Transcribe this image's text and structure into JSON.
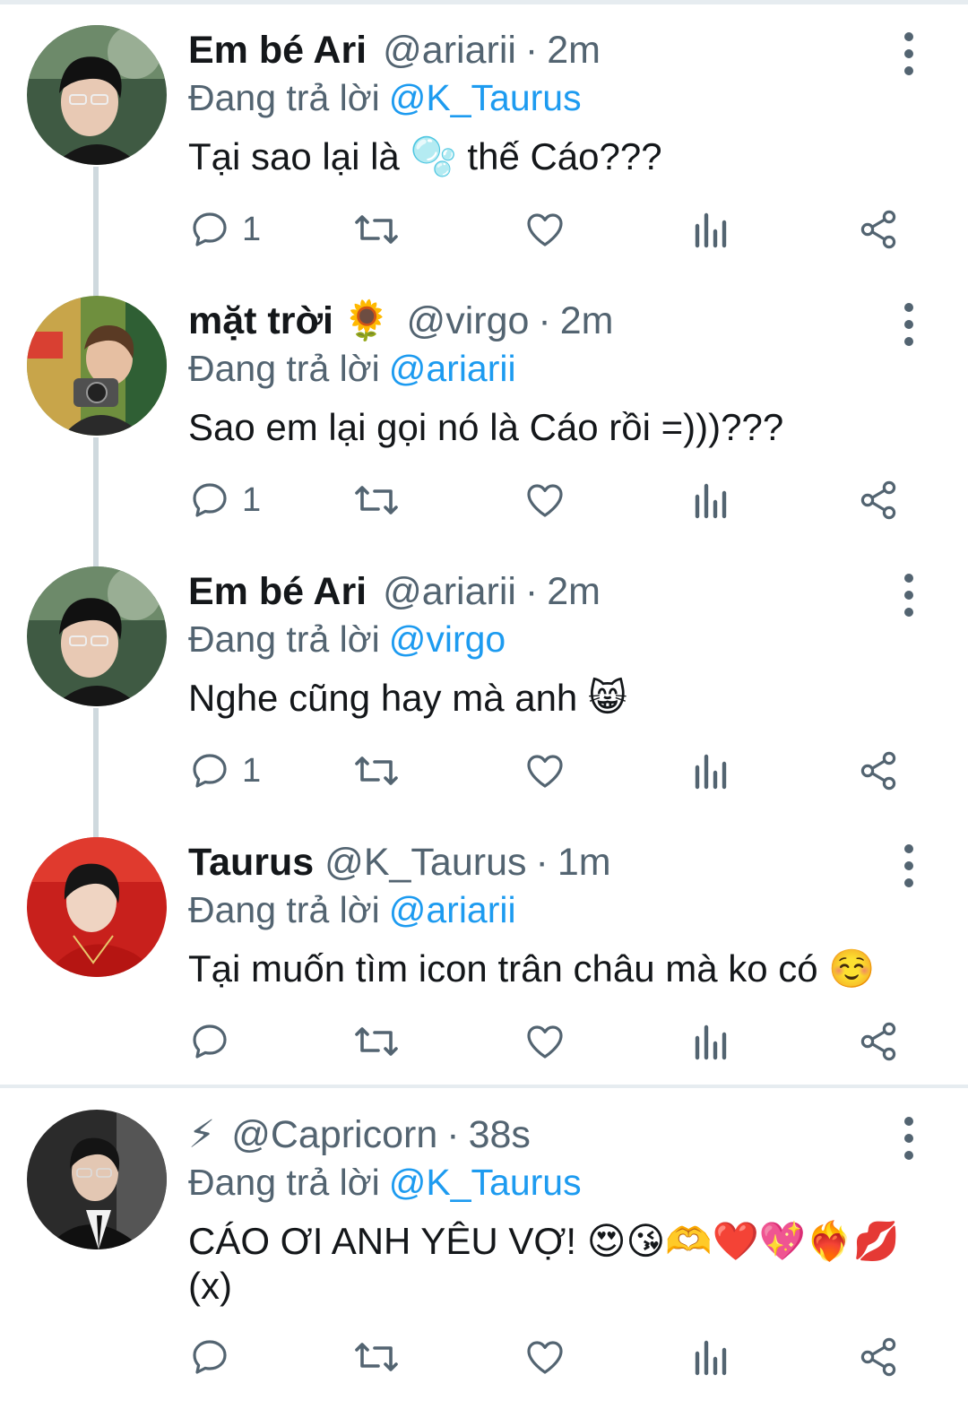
{
  "reply_prefix": "Đang trả lời",
  "tweets": [
    {
      "name": "Em bé Ari",
      "name_emoji": "",
      "handle": "@ariarii",
      "time": "2m",
      "reply_to": "@K_Taurus",
      "text_before": "Tại sao lại là ",
      "text_emoji": "🫧",
      "text_after": " thế Cáo???",
      "text_line2": "",
      "reply_count": "1",
      "avatar": "boy-with-glasses-green"
    },
    {
      "name": "mặt trời",
      "name_emoji": "🌻",
      "handle": "@virgo",
      "time": "2m",
      "reply_to": "@ariarii",
      "text_before": "Sao em lại gọi nó là Cáo rồi =)))???",
      "text_emoji": "",
      "text_after": "",
      "text_line2": "",
      "reply_count": "1",
      "avatar": "man-with-camera"
    },
    {
      "name": "Em bé Ari",
      "name_emoji": "",
      "handle": "@ariarii",
      "time": "2m",
      "reply_to": "@virgo",
      "text_before": "Nghe cũng hay mà anh ",
      "text_emoji": "😸",
      "text_after": "",
      "text_line2": "",
      "reply_count": "1",
      "avatar": "boy-with-glasses-green"
    },
    {
      "name": "Taurus",
      "name_emoji": "",
      "handle": "@K_Taurus",
      "time": "1m",
      "reply_to": "@ariarii",
      "text_before": "Tại muốn tìm icon trân châu mà ko có ",
      "text_emoji": "☺️",
      "text_after": "",
      "text_line2": "",
      "reply_count": "",
      "avatar": "man-red-background"
    },
    {
      "name": "",
      "name_emoji": "⚡",
      "handle": "@Capricorn",
      "time": "38s",
      "reply_to": "@K_Taurus",
      "text_before": "CÁO ƠI ANH YÊU VỢ! ",
      "text_emoji": "😍😘🫶❤️💖❤️‍🔥💋",
      "text_after": "",
      "text_line2": "(x)",
      "reply_count": "",
      "avatar": "man-in-suit"
    }
  ],
  "colors": {
    "link": "#1d9bf0",
    "secondary": "#536471",
    "thread_line": "#cfd9de",
    "separator": "#e6ecf0"
  }
}
